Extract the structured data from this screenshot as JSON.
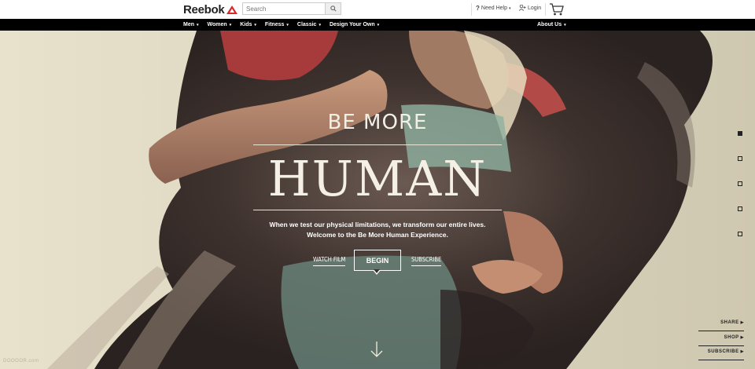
{
  "header": {
    "brand": "Reebok",
    "search_placeholder": "Search",
    "help_label": "Need Help",
    "login_label": "Login"
  },
  "nav": {
    "items": [
      "Men",
      "Women",
      "Kids",
      "Fitness",
      "Classic",
      "Design Your Own"
    ],
    "about": "About Us"
  },
  "hero": {
    "kicker": "BE MORE",
    "headline": "HUMAN",
    "tagline_1": "When we test our physical limitations, we transform our entire lives.",
    "tagline_2": "Welcome to the Be More Human Experience.",
    "watch_film": "WATCH FILM",
    "begin": "BEGIN",
    "subscribe": "SUBSCRIBE"
  },
  "pager": {
    "count": 5,
    "active_index": 0
  },
  "side_links": [
    "SHARE",
    "SHOP",
    "SUBSCRIBE"
  ],
  "watermark": "DOOOOR.com",
  "colors": {
    "nav_bg": "#000000",
    "brand_red": "#d62a2a",
    "paper": "#e9e4d2"
  }
}
